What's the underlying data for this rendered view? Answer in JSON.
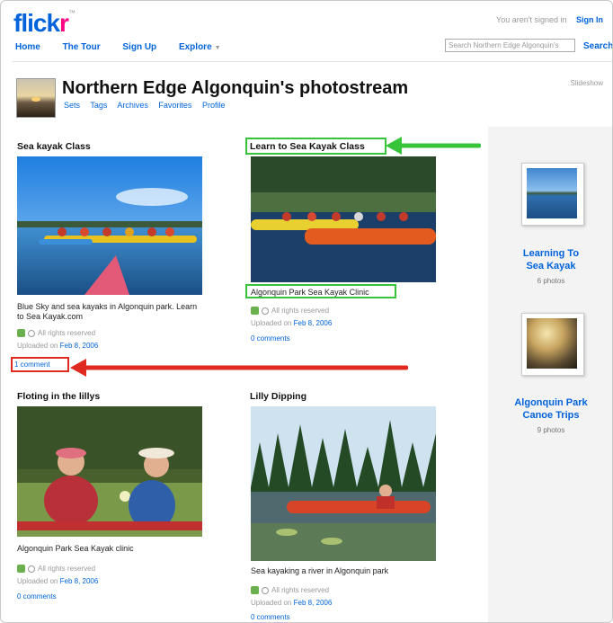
{
  "header": {
    "logo": {
      "main": "flick",
      "accent": "r",
      "tm": "™"
    },
    "signed_out_text": "You aren't signed in",
    "sign_in_label": "Sign In",
    "nav": [
      "Home",
      "The Tour",
      "Sign Up",
      "Explore"
    ],
    "search_placeholder": "Search Northern Edge Algonquin's",
    "search_button": "Search"
  },
  "stream": {
    "title": "Northern Edge Algonquin's photostream",
    "subnav": [
      "Sets",
      "Tags",
      "Archives",
      "Favorites",
      "Profile"
    ],
    "slideshow": "Slideshow"
  },
  "photos": [
    {
      "title": "Sea kayak Class",
      "description": "Blue Sky and sea kayaks in Algonquin park. Learn to Sea Kayak.com",
      "rights": "All rights reserved",
      "uploaded_prefix": "Uploaded on",
      "uploaded_date": "Feb 8, 2006",
      "comments": "1 comment"
    },
    {
      "title": "Learn to Sea Kayak Class",
      "description": "Algonquin Park Sea Kayak Clinic",
      "rights": "All rights reserved",
      "uploaded_prefix": "Uploaded on",
      "uploaded_date": "Feb 8, 2006",
      "comments": "0 comments"
    },
    {
      "title": "Floting in the lillys",
      "description": "Algonquin Park Sea Kayak clinic",
      "rights": "All rights reserved",
      "uploaded_prefix": "Uploaded on",
      "uploaded_date": "Feb 8, 2006",
      "comments": "0 comments"
    },
    {
      "title": "Lilly Dipping",
      "description": "Sea kayaking a river in Algonquin park",
      "rights": "All rights reserved",
      "uploaded_prefix": "Uploaded on",
      "uploaded_date": "Feb 8, 2006",
      "comments": "0 comments"
    }
  ],
  "sets": [
    {
      "title_line1": "Learning To",
      "title_line2": "Sea Kayak",
      "count": "6 photos"
    },
    {
      "title_line1": "Algonquin Park",
      "title_line2": "Canoe Trips",
      "count": "9 photos"
    }
  ],
  "colors": {
    "link": "#0063dc",
    "logo_accent": "#ff0084",
    "highlight_green": "#35c43a",
    "highlight_red": "#e02a1f"
  },
  "icons": [
    "creative-commons-icon",
    "copyright-icon",
    "chevron-down-icon"
  ]
}
